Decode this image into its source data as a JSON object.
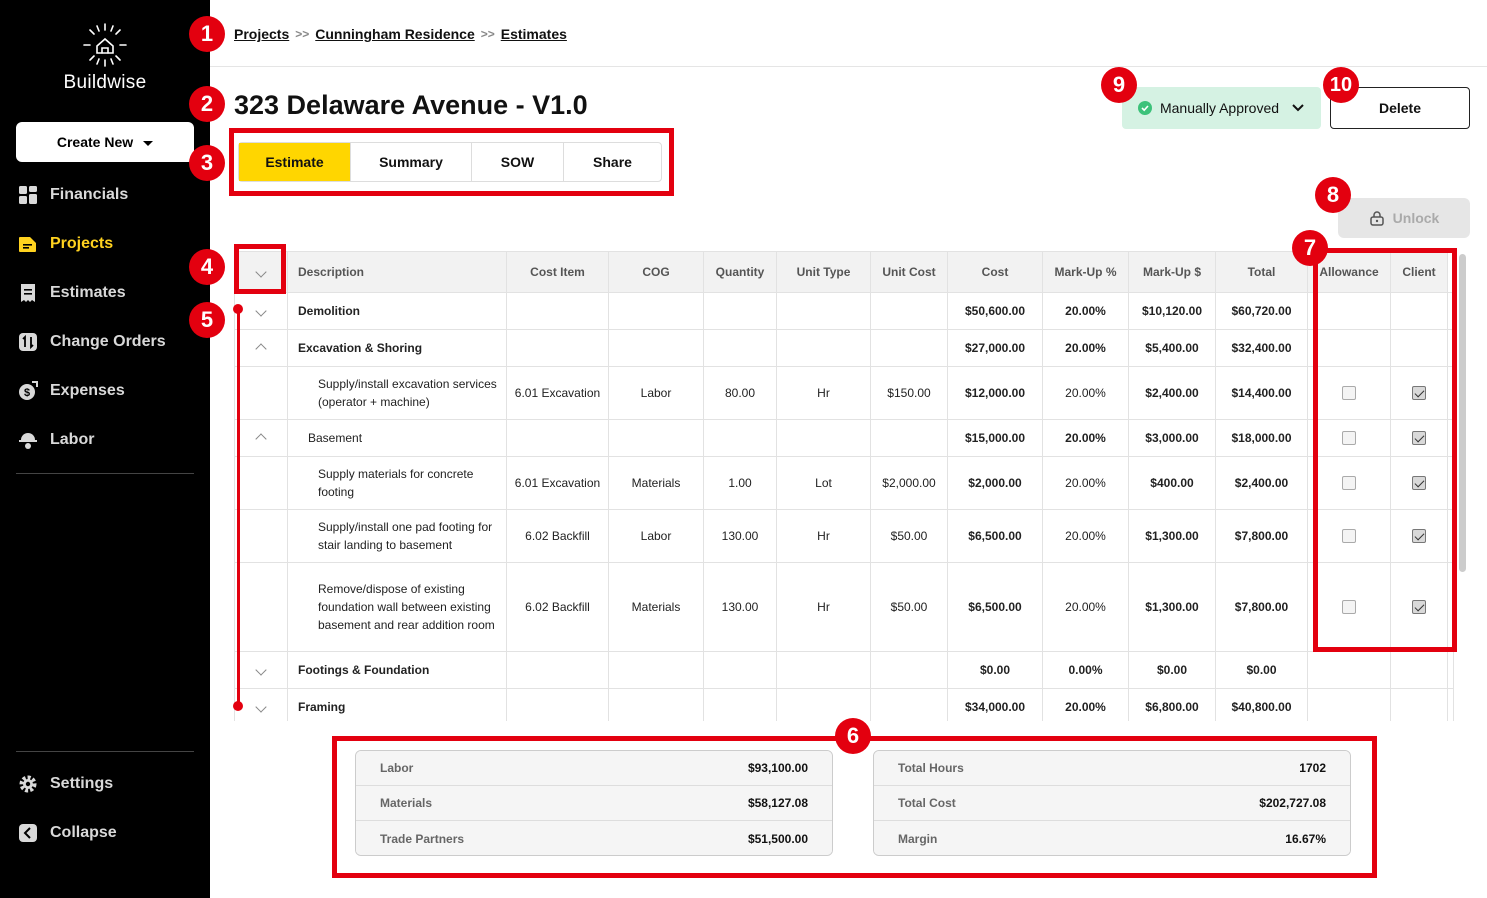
{
  "sidebar": {
    "brand": "Buildwise",
    "create_new": "Create New",
    "nav": [
      {
        "label": "Financials",
        "icon": "grid-icon"
      },
      {
        "label": "Projects",
        "icon": "folder-icon"
      },
      {
        "label": "Estimates",
        "icon": "receipt-icon"
      },
      {
        "label": "Change Orders",
        "icon": "swap-icon"
      },
      {
        "label": "Expenses",
        "icon": "coin-icon"
      },
      {
        "label": "Labor",
        "icon": "hardhat-icon"
      }
    ],
    "settings": "Settings",
    "collapse": "Collapse",
    "accent_color": "#ffd21f"
  },
  "breadcrumb": [
    "Projects",
    "Cunningham Residence",
    "Estimates"
  ],
  "page": {
    "title": "323 Delaware Avenue - V1.0",
    "tabs": [
      "Estimate",
      "Summary",
      "SOW",
      "Share"
    ],
    "active_tab": "Estimate",
    "status": "Manually Approved",
    "delete": "Delete",
    "unlock": "Unlock"
  },
  "table": {
    "headers": [
      "Description",
      "Cost Item",
      "COG",
      "Quantity",
      "Unit Type",
      "Unit Cost",
      "Cost",
      "Mark-Up %",
      "Mark-Up $",
      "Total",
      "Allowance",
      "Client"
    ],
    "rows": [
      {
        "kind": "group",
        "chevron": "down",
        "desc": "Demolition",
        "cost": "$50,600.00",
        "mp": "20.00%",
        "md": "$10,120.00",
        "total": "$60,720.00"
      },
      {
        "kind": "group",
        "chevron": "up",
        "desc": "Excavation & Shoring",
        "cost": "$27,000.00",
        "mp": "20.00%",
        "md": "$5,400.00",
        "total": "$32,400.00"
      },
      {
        "kind": "item",
        "desc": "Supply/install excavation services (operator + machine)",
        "item": "6.01 Excavation",
        "cog": "Labor",
        "qty": "80.00",
        "unit": "Hr",
        "ucost": "$150.00",
        "cost": "$12,000.00",
        "mp": "20.00%",
        "md": "$2,400.00",
        "total": "$14,400.00",
        "allowance": false,
        "client": true
      },
      {
        "kind": "subgroup",
        "chevron": "up",
        "desc": "Basement",
        "cost": "$15,000.00",
        "mp": "20.00%",
        "md": "$3,000.00",
        "total": "$18,000.00",
        "allowance": false,
        "client": true
      },
      {
        "kind": "item",
        "desc": "Supply materials for concrete footing",
        "item": "6.01 Excavation",
        "cog": "Materials",
        "qty": "1.00",
        "unit": "Lot",
        "ucost": "$2,000.00",
        "cost": "$2,000.00",
        "mp": "20.00%",
        "md": "$400.00",
        "total": "$2,400.00",
        "allowance": false,
        "client": true
      },
      {
        "kind": "item",
        "desc": "Supply/install one pad footing for stair landing to basement",
        "item": "6.02 Backfill",
        "cog": "Labor",
        "qty": "130.00",
        "unit": "Hr",
        "ucost": "$50.00",
        "cost": "$6,500.00",
        "mp": "20.00%",
        "md": "$1,300.00",
        "total": "$7,800.00",
        "allowance": false,
        "client": true
      },
      {
        "kind": "item",
        "desc": "Remove/dispose of existing foundation wall between existing basement and rear addition room",
        "item": "6.02 Backfill",
        "cog": "Materials",
        "qty": "130.00",
        "unit": "Hr",
        "ucost": "$50.00",
        "cost": "$6,500.00",
        "mp": "20.00%",
        "md": "$1,300.00",
        "total": "$7,800.00",
        "allowance": false,
        "client": true
      },
      {
        "kind": "group",
        "chevron": "down",
        "desc": "Footings & Foundation",
        "cost": "$0.00",
        "mp": "0.00%",
        "md": "$0.00",
        "total": "$0.00"
      },
      {
        "kind": "group",
        "chevron": "down",
        "desc": "Framing",
        "cost": "$34,000.00",
        "mp": "20.00%",
        "md": "$6,800.00",
        "total": "$40,800.00"
      }
    ]
  },
  "summary": {
    "left": [
      {
        "label": "Labor",
        "value": "$93,100.00"
      },
      {
        "label": "Materials",
        "value": "$58,127.08"
      },
      {
        "label": "Trade Partners",
        "value": "$51,500.00"
      }
    ],
    "right": [
      {
        "label": "Total Hours",
        "value": "1702"
      },
      {
        "label": "Total Cost",
        "value": "$202,727.08"
      },
      {
        "label": "Margin",
        "value": "16.67%"
      }
    ]
  },
  "annotations": [
    "1",
    "2",
    "3",
    "4",
    "5",
    "6",
    "7",
    "8",
    "9",
    "10"
  ]
}
